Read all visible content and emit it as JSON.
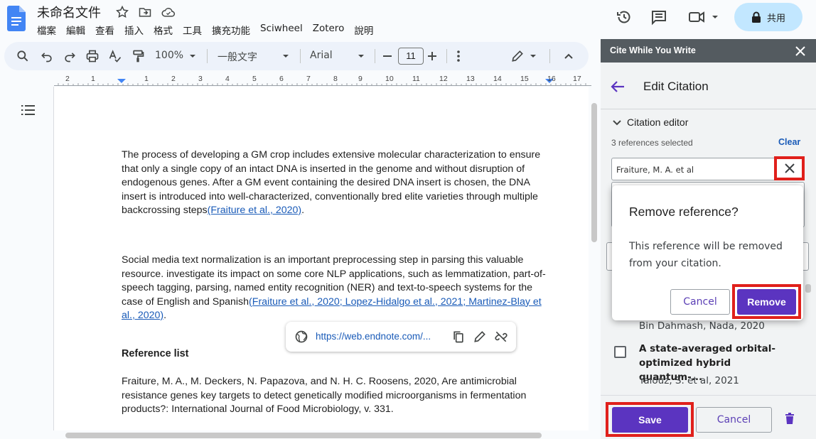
{
  "doc": {
    "title": "未命名文件",
    "menu": [
      "檔案",
      "編輯",
      "查看",
      "插入",
      "格式",
      "工具",
      "擴充功能",
      "Sciwheel",
      "Zotero",
      "說明"
    ]
  },
  "share": {
    "label": "共用"
  },
  "toolbar": {
    "zoom": "100%",
    "style": "一般文字",
    "font": "Arial",
    "font_size": "11"
  },
  "ruler": {
    "numbers": [
      "2",
      "1",
      "",
      "1",
      "2",
      "3",
      "4",
      "5",
      "6",
      "7",
      "8",
      "9",
      "10",
      "11",
      "12",
      "13",
      "14",
      "15",
      "16",
      "17"
    ]
  },
  "document": {
    "para1_text": "The process of developing a GM crop includes extensive molecular characterization to ensure that only a single copy of an intact DNA is inserted in the genome and without disruption of endogenous genes. After a GM event containing the desired DNA insert is chosen, the DNA insert is introduced into well-characterized, conventionally bred elite varieties through multiple backcrossing steps",
    "para1_cite": "(Fraiture et al., 2020)",
    "para1_end": ".",
    "para2_text": "Social media text normalization is an important preprocessing step in parsing this valuable resource. investigate its impact on some core NLP applications, such as lemmatization, part-of-speech tagging, parsing, named entity recognition (NER) and text-to-speech systems for the case of English and Spanish",
    "para2_cite": "(Fraiture et al., 2020; Lopez-Hidalgo et al., 2021; Martinez-Blay et al., 2020)",
    "para2_end": ".",
    "ref_heading": "Reference list",
    "ref1": "Fraiture, M. A., M. Deckers, N. Papazova, and N. H. C. Roosens, 2020, Are antimicrobial resistance genes key targets to detect genetically modified microorganisms in fermentation products?: International Journal of Food Microbiology, v. 331."
  },
  "link_chip": {
    "url": "https://web.endnote.com/..."
  },
  "panel": {
    "header": "Cite While You Write",
    "edit_title": "Edit Citation",
    "editor_label": "Citation editor",
    "refs_selected": "3 references selected",
    "clear": "Clear",
    "ref_input": "Fraiture, M. A. et al",
    "items": [
      {
        "author": "Bin Dahmash, Nada, 2020"
      },
      {
        "title": "A state-averaged orbital-optimized hybrid quantum-...",
        "author": "Yalouz, S. et al, 2021"
      }
    ],
    "save": "Save",
    "cancel": "Cancel"
  },
  "dialog": {
    "title": "Remove reference?",
    "body": "This reference will be removed from your citation.",
    "cancel": "Cancel",
    "remove": "Remove"
  },
  "colors": {
    "accent": "#5b34c0",
    "highlight": "#e0201b",
    "panel_header": "#545b60",
    "share_bg": "#c2e7ff"
  }
}
